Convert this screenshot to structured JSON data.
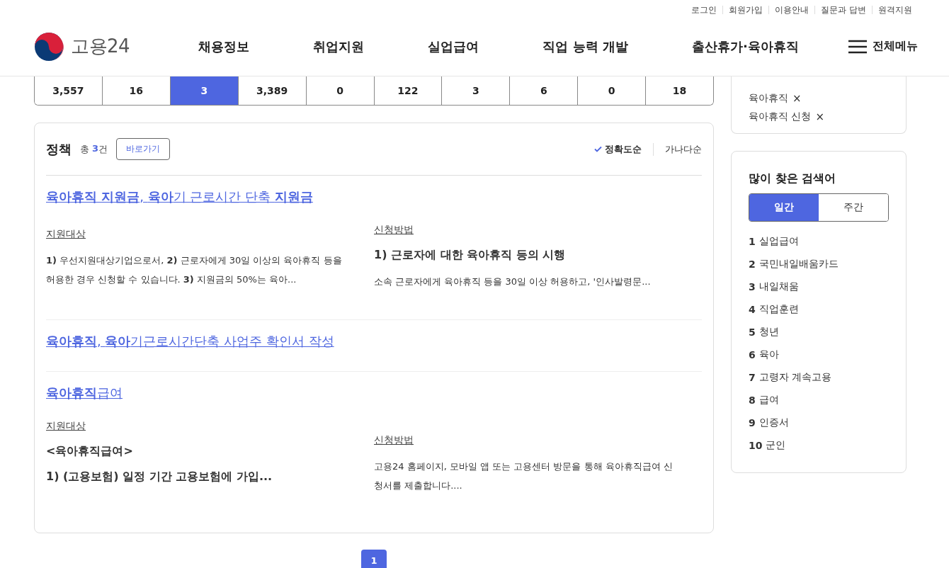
{
  "util_links": [
    "로그인",
    "회원가입",
    "이용안내",
    "질문과 답변",
    "원격지원"
  ],
  "logo": {
    "text": "고용24"
  },
  "nav": [
    "채용정보",
    "취업지원",
    "실업급여",
    "직업 능력 개발",
    "출산휴가·육아휴직"
  ],
  "all_menu": "전체메뉴",
  "counts": [
    {
      "value": "3,557",
      "selected": false
    },
    {
      "value": "16",
      "selected": false
    },
    {
      "value": "3",
      "selected": true
    },
    {
      "value": "3,389",
      "selected": false
    },
    {
      "value": "0",
      "selected": false
    },
    {
      "value": "122",
      "selected": false
    },
    {
      "value": "3",
      "selected": false
    },
    {
      "value": "6",
      "selected": false
    },
    {
      "value": "0",
      "selected": false
    },
    {
      "value": "18",
      "selected": false
    }
  ],
  "policy": {
    "title": "정책",
    "total_prefix": "총",
    "total_count": "3",
    "total_suffix": "건",
    "go_button": "바로가기",
    "sort": [
      {
        "label": "정확도순",
        "selected": true
      },
      {
        "label": "가나다순",
        "selected": false
      }
    ],
    "results": [
      {
        "title": "**육아휴직 지원금**, **육아**기 근로시간 단축 **지원금**",
        "target": {
          "heading": "지원대상",
          "paragraphs": [
            {
              "kind": "plain",
              "text": "**1)** 우선지원대상기업으로서, **2)** 근로자에게 30일 이상의 육아휴직 등을 허용한 경우 신청할 수 있습니다. **3)** 지원금의 50%는 육아..."
            }
          ]
        },
        "method": {
          "heading": "신청방법",
          "paragraphs": [
            {
              "kind": "bold",
              "text": "1) 근로자에 대한 육아휴직 등의 시행"
            },
            {
              "kind": "plain",
              "text": "소속 근로자에게 육아휴직 등을 30일 이상 허용하고, '인사발령문..."
            }
          ]
        }
      },
      {
        "title": "**육아휴직**, **육아**기근로시간단축 사업주 확인서 작성"
      },
      {
        "title": "**육아휴직**급여",
        "target": {
          "heading": "지원대상",
          "paragraphs": [
            {
              "kind": "bold",
              "text": "<육아휴직급여>"
            },
            {
              "kind": "bold",
              "text": "1) (고용보험) 일정 기간 고용보험에 가입..."
            }
          ]
        },
        "method": {
          "heading": "신청방법",
          "paragraphs": [
            {
              "kind": "plain",
              "text": "고용24 홈페이지, 모바일 앱 또는 고용센터 방문을 통해 육아휴직급여 신청서를 제출합니다...."
            }
          ]
        }
      }
    ]
  },
  "recent_searches": [
    {
      "term": "육아휴직",
      "remove": "×"
    },
    {
      "term": "육아휴직 신청",
      "remove": "×"
    }
  ],
  "popular": {
    "title": "많이 찾은 검색어",
    "tabs": [
      {
        "label": "일간",
        "selected": true
      },
      {
        "label": "주간",
        "selected": false
      }
    ],
    "items": [
      {
        "rank": "1",
        "term": "실업급여"
      },
      {
        "rank": "2",
        "term": "국민내일배움카드"
      },
      {
        "rank": "3",
        "term": "내일채움"
      },
      {
        "rank": "4",
        "term": "직업훈련"
      },
      {
        "rank": "5",
        "term": "청년"
      },
      {
        "rank": "6",
        "term": "육아"
      },
      {
        "rank": "7",
        "term": "고령자 계속고용"
      },
      {
        "rank": "8",
        "term": "급여"
      },
      {
        "rank": "9",
        "term": "인증서"
      },
      {
        "rank": "10",
        "term": "군인"
      }
    ]
  },
  "pagination": [
    {
      "label": "1",
      "selected": true
    }
  ]
}
